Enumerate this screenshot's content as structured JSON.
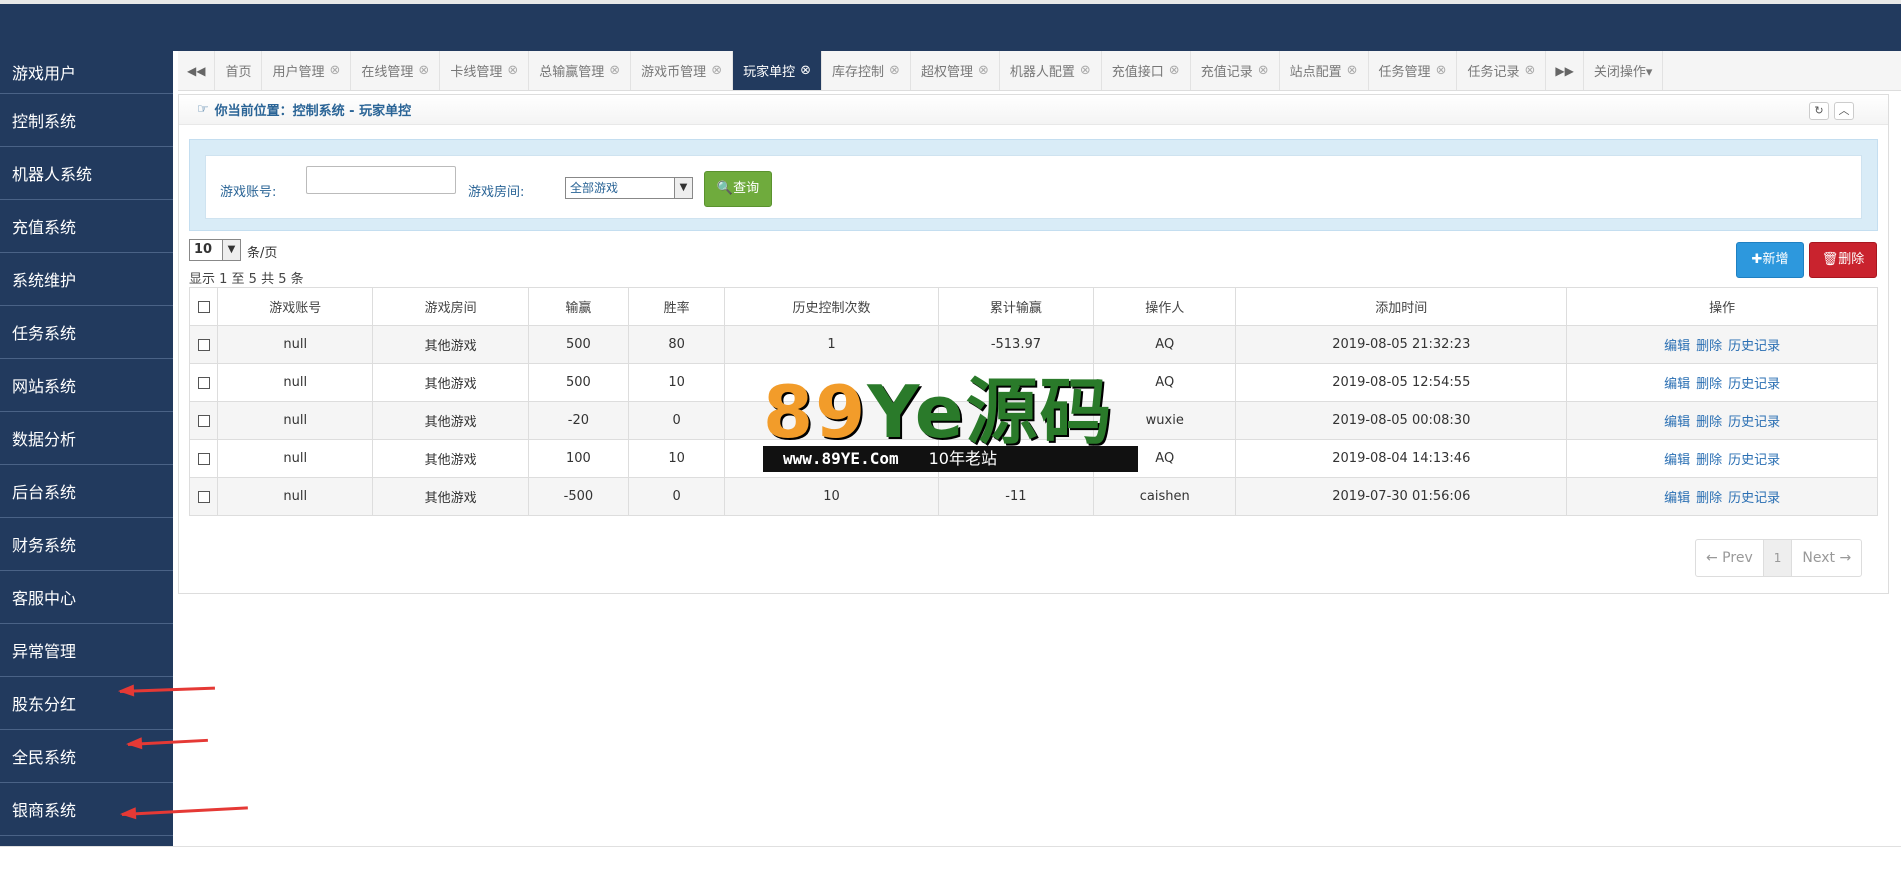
{
  "sidebar": {
    "items": [
      "游戏用户",
      "控制系统",
      "机器人系统",
      "充值系统",
      "系统维护",
      "任务系统",
      "网站系统",
      "数据分析",
      "后台系统",
      "财务系统",
      "客服中心",
      "异常管理",
      "股东分红",
      "全民系统",
      "银商系统"
    ]
  },
  "tabs": {
    "prev": "◀◀",
    "items": [
      {
        "label": "首页",
        "closable": false
      },
      {
        "label": "用户管理",
        "closable": true
      },
      {
        "label": "在线管理",
        "closable": true
      },
      {
        "label": "卡线管理",
        "closable": true
      },
      {
        "label": "总输赢管理",
        "closable": true
      },
      {
        "label": "游戏币管理",
        "closable": true
      },
      {
        "label": "玩家单控",
        "closable": true,
        "active": true
      },
      {
        "label": "库存控制",
        "closable": true
      },
      {
        "label": "超权管理",
        "closable": true
      },
      {
        "label": "机器人配置",
        "closable": true
      },
      {
        "label": "充值接口",
        "closable": true
      },
      {
        "label": "充值记录",
        "closable": true
      },
      {
        "label": "站点配置",
        "closable": true
      },
      {
        "label": "任务管理",
        "closable": true
      },
      {
        "label": "任务记录",
        "closable": true
      }
    ],
    "next": "▶▶",
    "close_ops": "关闭操作▾",
    "close_glyph": "⊗"
  },
  "breadcrumb": {
    "text": "你当前位置：控制系统 - 玩家单控",
    "hand": "☞",
    "refresh_icon": "↻",
    "collapse_icon": "︿"
  },
  "search": {
    "account_label": "游戏账号:",
    "account_value": "",
    "room_label": "游戏房间:",
    "room_value": "全部游戏",
    "query_label": "🔍查询"
  },
  "list": {
    "page_size": "10",
    "per_page_label": "条/页",
    "info": "显示 1 至 5 共 5 条",
    "add_label": "✚新增",
    "delete_label": "🗑删除"
  },
  "table": {
    "columns": [
      "",
      "游戏账号",
      "游戏房间",
      "输赢",
      "胜率",
      "历史控制次数",
      "累计输赢",
      "操作人",
      "添加时间",
      "操作"
    ],
    "rows": [
      [
        "null",
        "其他游戏",
        "500",
        "80",
        "1",
        "-513.97",
        "AQ",
        "2019-08-05 21:32:23"
      ],
      [
        "null",
        "其他游戏",
        "500",
        "10",
        "",
        "",
        "AQ",
        "2019-08-05 12:54:55"
      ],
      [
        "null",
        "其他游戏",
        "-20",
        "0",
        "",
        "",
        "wuxie",
        "2019-08-05 00:08:30"
      ],
      [
        "null",
        "其他游戏",
        "100",
        "10",
        "",
        "",
        "AQ",
        "2019-08-04 14:13:46"
      ],
      [
        "null",
        "其他游戏",
        "-500",
        "0",
        "10",
        "-11",
        "caishen",
        "2019-07-30 01:56:06"
      ]
    ],
    "actions": [
      "编辑",
      "删除",
      "历史记录"
    ]
  },
  "pager": {
    "prev": "← Prev",
    "current": "1",
    "next": "Next →"
  },
  "watermark": {
    "big_a": "89",
    "big_b": "Ye源码",
    "url": "www.89YE.Com",
    "sub": "10年老站"
  },
  "colors": {
    "nav_bg": "#223a5e",
    "accent_red": "#e53935",
    "query_green": "#6fab3d",
    "add_blue": "#2d98dd",
    "delete_red": "#c9232e"
  }
}
